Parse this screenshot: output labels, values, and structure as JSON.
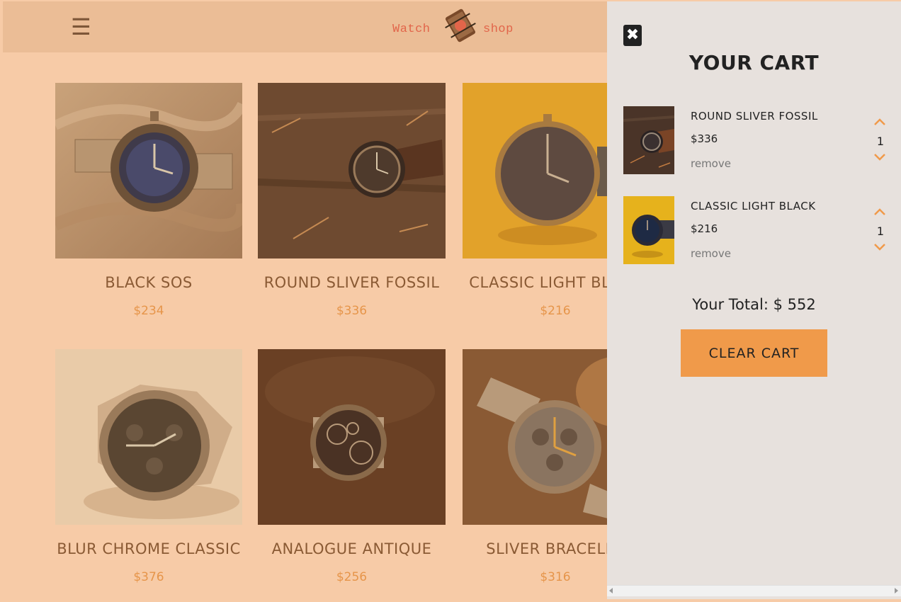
{
  "navbar": {
    "menu_icon": "☰",
    "logo_left": "Watch",
    "logo_right": "shop"
  },
  "products": [
    {
      "name": "BLACK SOS",
      "price": "$234"
    },
    {
      "name": "ROUND SLIVER FOSSIL",
      "price": "$336"
    },
    {
      "name": "CLASSIC LIGHT BLACK",
      "price": "$216"
    },
    {
      "name": "BLUR CHROME CLASSIC",
      "price": "$376"
    },
    {
      "name": "ANALOGUE ANTIQUE",
      "price": "$256"
    },
    {
      "name": "SLIVER BRACELET",
      "price": "$316"
    }
  ],
  "cart": {
    "close_icon": "✖",
    "title": "YOUR CART",
    "items": [
      {
        "name": "ROUND SLIVER FOSSIL",
        "price": "$336",
        "remove": "remove",
        "qty": "1"
      },
      {
        "name": "CLASSIC LIGHT BLACK",
        "price": "$216",
        "remove": "remove",
        "qty": "1"
      }
    ],
    "total_text": "Your Total: $ 552",
    "clear_label": "CLEAR CART"
  },
  "colors": {
    "page_bg": "#f7cba7",
    "navbar_bg": "#ebbd96",
    "product_name": "#8a5a34",
    "product_price": "#e6954a",
    "cart_bg": "#e7e1dd",
    "accent": "#f09a4a",
    "logo": "#e2654a"
  }
}
